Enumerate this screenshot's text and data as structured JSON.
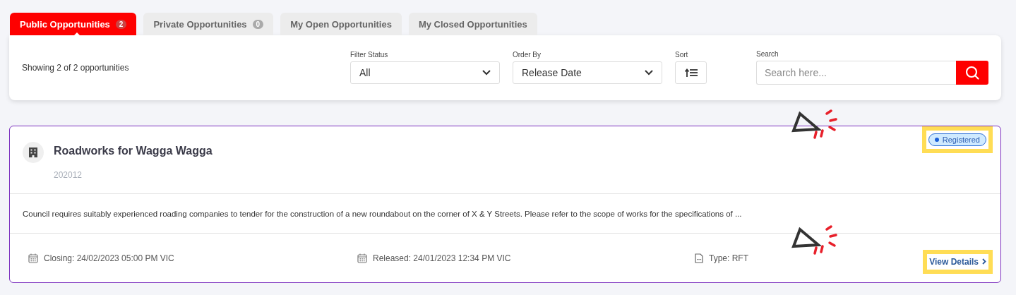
{
  "tabs": [
    {
      "label": "Public Opportunities",
      "count": "2",
      "selected": true
    },
    {
      "label": "Private Opportunities",
      "count": "0",
      "selected": false
    },
    {
      "label": "My Open Opportunities",
      "selected": false
    },
    {
      "label": "My Closed Opportunities",
      "selected": false
    }
  ],
  "toolbar": {
    "summary": "Showing 2 of 2 opportunities",
    "filter_status": {
      "label": "Filter Status",
      "value": "All"
    },
    "order_by": {
      "label": "Order By",
      "value": "Release Date"
    },
    "sort": {
      "label": "Sort"
    },
    "search": {
      "label": "Search",
      "placeholder": "Search here..."
    }
  },
  "opportunity": {
    "title": "Roadworks for Wagga Wagga",
    "reference": "202012",
    "status": "Registered",
    "description": "Council requires suitably experienced roading companies to tender for the construction of a new roundabout on the corner of X & Y Streets. Please refer to the scope of works for the specifications of ...",
    "closing": "Closing: 24/02/2023 05:00 PM VIC",
    "released": "Released: 24/01/2023 12:34 PM VIC",
    "type": "Type: RFT",
    "link": "View Details"
  }
}
